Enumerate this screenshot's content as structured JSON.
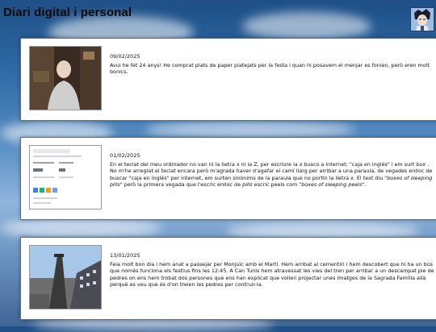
{
  "site": {
    "title": "Diari digital i personal"
  },
  "posts": [
    {
      "date": "09/02/2025",
      "parts": [
        {
          "text": "Avui he fet 24 anys! He comprat plats de paper platejats per la festa i quan hi posavem el menjar es fonien, però eren molt bonics.",
          "style": "normal"
        }
      ]
    },
    {
      "date": "01/02/2025",
      "parts": [
        {
          "text": "En el teclat del meu ordinador no van ni la lletra x ni la Z, per escriure la x busco a internet: \"caja en inglés\" i em surt ",
          "style": "normal"
        },
        {
          "text": "box",
          "style": "italic"
        },
        {
          "text": " . No m'he arreglat el teclat encara però m'agrada haver d'agafar el camí llarg per arribar a una paraula, de vegades enlloc de buscar \"caja en inglés\" per internet, em surten sinònims de la paraula que no portin la lletra x. El text diu ",
          "style": "normal"
        },
        {
          "text": "\"boxes of sleeping pills\"",
          "style": "italic"
        },
        {
          "text": " però la primera vegada que l'escric enlloc de ",
          "style": "normal"
        },
        {
          "text": "pills",
          "style": "italic"
        },
        {
          "text": " escric peels com ",
          "style": "normal"
        },
        {
          "text": "\"boxes of sleeping peels\".",
          "style": "italic"
        }
      ]
    },
    {
      "date": "13/01/2025",
      "parts": [
        {
          "text": "Feia molt bon dia i hem anat a passejar per Monjuïc amb el Martí. Hem arribat al cementiri i hem descobert que hi ha un bús que només funciona els festius fins les 12:45. A Can Tunis hem atravessat les vies del tren per arribar a un descampat ple de pedres on ens hem trobat dos persones que ens han explicat que volien projectar unes imatges de la Sagrada Família allà perquè es veu que és d'on treien les pedres per contruir-la.",
          "style": "normal"
        }
      ]
    }
  ]
}
